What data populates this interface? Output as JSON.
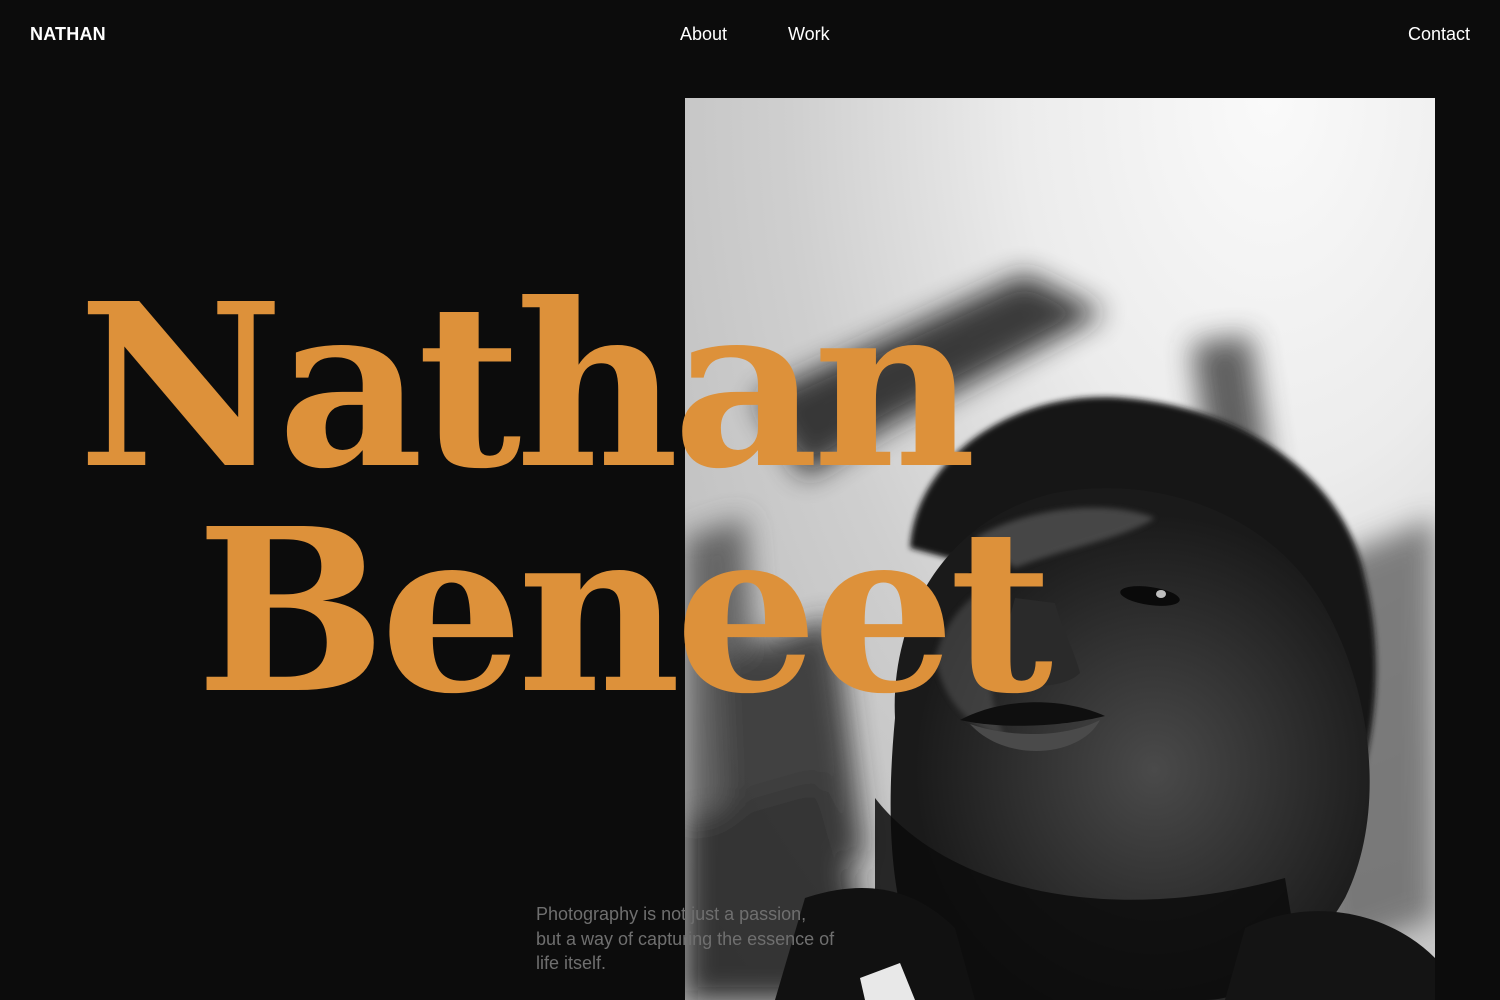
{
  "nav": {
    "brand": "NATHAN",
    "links": [
      {
        "label": "About"
      },
      {
        "label": "Work"
      },
      {
        "label": "Contact"
      }
    ]
  },
  "hero": {
    "first_name": "Nathan",
    "last_name": "Beneet",
    "tagline": "Photography is not just a passion, but a way of capturing the essence of life itself."
  },
  "colors": {
    "background": "#0c0c0c",
    "accent": "#dd913a",
    "nav_text": "#ffffff",
    "tagline_text": "#6f6f6f"
  },
  "photo": {
    "subject": "black-and-white portrait of a man looking upward"
  }
}
